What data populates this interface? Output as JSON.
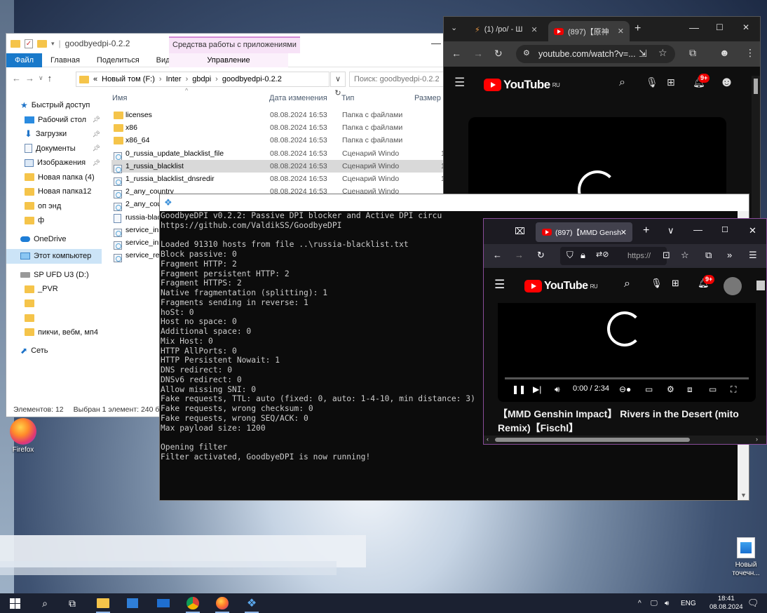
{
  "colors": {
    "accent": "#1979ca",
    "yt_red": "#ff0000",
    "console_bg": "#0c0c0c",
    "console_fg": "#cccccc"
  },
  "desktop": {
    "icons": [
      {
        "label": "Firefox",
        "icon": "firefox-icon"
      },
      {
        "label": "Новый точечн...",
        "icon": "image-file-icon"
      }
    ]
  },
  "explorer": {
    "title": "goodbyedpi-0.2.2",
    "context_tab": "Средства работы с приложениями",
    "ribbon": {
      "file": "Файл",
      "home": "Главная",
      "share": "Поделиться",
      "view": "Вид",
      "manage": "Управление"
    },
    "address": {
      "prefix": "«",
      "crumbs": [
        "Новый том (F:)",
        "Inter",
        "gbdpi",
        "goodbyedpi-0.2.2"
      ],
      "search_placeholder": "Поиск: goodbyedpi-0.2.2"
    },
    "nav": [
      {
        "label": "Быстрый доступ",
        "icon": "star-icon"
      },
      {
        "label": "Рабочий стол",
        "icon": "desktop-icon",
        "pinned": true
      },
      {
        "label": "Загрузки",
        "icon": "download-icon",
        "pinned": true
      },
      {
        "label": "Документы",
        "icon": "documents-icon",
        "pinned": true
      },
      {
        "label": "Изображения",
        "icon": "pictures-icon",
        "pinned": true
      },
      {
        "label": "Новая папка (4)",
        "icon": "folder-icon"
      },
      {
        "label": "Новая папка12",
        "icon": "folder-icon"
      },
      {
        "label": "оп энд",
        "icon": "folder-icon"
      },
      {
        "label": "ф",
        "icon": "folder-icon"
      },
      {
        "label": "OneDrive",
        "icon": "cloud-icon"
      },
      {
        "label": "Этот компьютер",
        "icon": "computer-icon"
      },
      {
        "label": "SP UFD U3 (D:)",
        "icon": "drive-icon"
      },
      {
        "label": "_PVR",
        "icon": "folder-icon"
      },
      {
        "label": "",
        "icon": "folder-icon"
      },
      {
        "label": "",
        "icon": "folder-icon"
      },
      {
        "label": "пикчи, вебм, мп4",
        "icon": "folder-icon"
      },
      {
        "label": "Сеть",
        "icon": "network-icon"
      }
    ],
    "columns": {
      "name": "Имя",
      "date": "Дата изменения",
      "type": "Тип",
      "size": "Размер"
    },
    "files": [
      {
        "name": "licenses",
        "date": "08.08.2024 16:53",
        "type": "Папка с файлами",
        "size": "",
        "icon": "folder-icon"
      },
      {
        "name": "x86",
        "date": "08.08.2024 16:53",
        "type": "Папка с файлами",
        "size": "",
        "icon": "folder-icon"
      },
      {
        "name": "x86_64",
        "date": "08.08.2024 16:53",
        "type": "Папка с файлами",
        "size": "",
        "icon": "folder-icon"
      },
      {
        "name": "0_russia_update_blacklist_file",
        "date": "08.08.2024 16:53",
        "type": "Сценарий Windo",
        "size": "1",
        "icon": "script-icon"
      },
      {
        "name": "1_russia_blacklist",
        "date": "08.08.2024 16:53",
        "type": "Сценарий Windo",
        "size": "1",
        "icon": "script-icon"
      },
      {
        "name": "1_russia_blacklist_dnsredir",
        "date": "08.08.2024 16:53",
        "type": "Сценарий Windo",
        "size": "1",
        "icon": "script-icon"
      },
      {
        "name": "2_any_country",
        "date": "08.08.2024 16:53",
        "type": "Сценарий Windo",
        "size": "",
        "icon": "script-icon"
      },
      {
        "name": "2_any_cou",
        "date": "",
        "type": "",
        "size": "",
        "icon": "script-icon"
      },
      {
        "name": "russia-blac",
        "date": "",
        "type": "",
        "size": "",
        "icon": "text-file-icon"
      },
      {
        "name": "service_ins",
        "date": "",
        "type": "",
        "size": "",
        "icon": "script-icon"
      },
      {
        "name": "service_ins",
        "date": "",
        "type": "",
        "size": "",
        "icon": "script-icon"
      },
      {
        "name": "service_ren",
        "date": "",
        "type": "",
        "size": "",
        "icon": "script-icon"
      }
    ],
    "selected_index": 4,
    "status": {
      "count": "Элементов: 12",
      "selected": "Выбран 1 элемент: 240 ба"
    }
  },
  "console": {
    "lines": [
      "GoodbyeDPI v0.2.2: Passive DPI blocker and Active DPI circu",
      "https://github.com/ValdikSS/GoodbyeDPI",
      "",
      "Loaded 91310 hosts from file ..\\russia-blacklist.txt",
      "Block passive: 0",
      "Fragment HTTP: 2",
      "Fragment persistent HTTP: 2",
      "Fragment HTTPS: 2",
      "Native fragmentation (splitting): 1",
      "Fragments sending in reverse: 1",
      "hoSt: 0",
      "Host no space: 0",
      "Additional space: 0",
      "Mix Host: 0",
      "HTTP AllPorts: 0",
      "HTTP Persistent Nowait: 1",
      "DNS redirect: 0",
      "DNSv6 redirect: 0",
      "Allow missing SNI: 0",
      "Fake requests, TTL: auto (fixed: 0, auto: 1-4-10, min distance: 3)",
      "Fake requests, wrong checksum: 0",
      "Fake requests, wrong SEQ/ACK: 0",
      "Max payload size: 1200",
      "",
      "Opening filter",
      "Filter activated, GoodbyeDPI is now running!"
    ]
  },
  "chrome": {
    "tabs": [
      {
        "title": "(1) /po/ - Ш",
        "icon": "site-favicon-icon"
      },
      {
        "title": "(897)【原神",
        "icon": "youtube-favicon-icon",
        "active": true
      }
    ],
    "url": "youtube.com/watch?v=...",
    "yt_logo": "YouTube",
    "yt_region": "RU",
    "notifications": "9+"
  },
  "firefox": {
    "tab_title": "(897)【MMD Gensh",
    "url": "https://",
    "yt_logo": "YouTube",
    "yt_region": "RU",
    "notifications": "9+",
    "time": "0:00 / 2:34",
    "video_title": "【MMD Genshin Impact】 Rivers in the Desert (mito Remix)【Fischl】"
  },
  "taskbar": {
    "lang": "ENG",
    "time": "18:41",
    "date": "08.08.2024"
  }
}
